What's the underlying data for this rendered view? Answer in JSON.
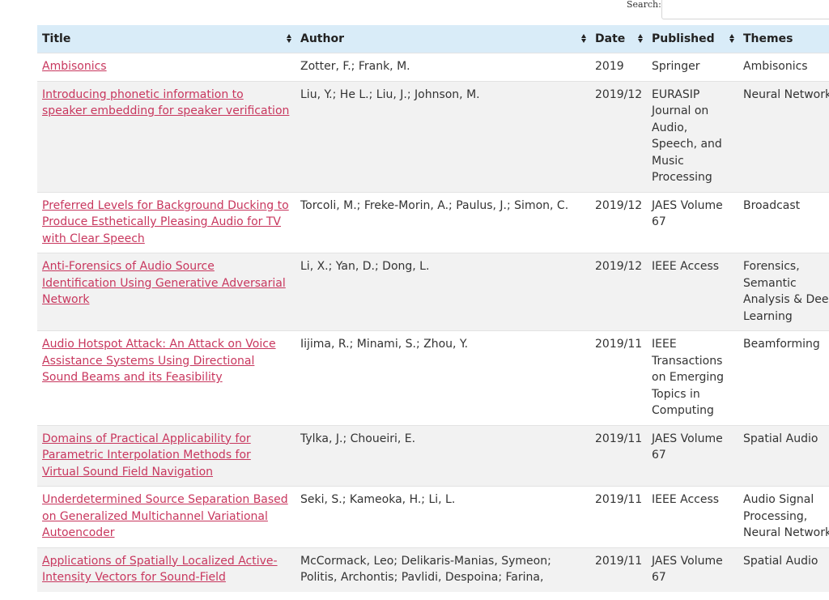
{
  "search": {
    "label": "Search:",
    "value": ""
  },
  "table": {
    "columns": [
      "Title",
      "Author",
      "Date",
      "Published",
      "Themes"
    ],
    "rows": [
      {
        "title": "Ambisonics",
        "author": "Zotter, F.; Frank, M.",
        "date": "2019",
        "published": "Springer",
        "themes": "Ambisonics"
      },
      {
        "title": "Introducing phonetic information to speaker embedding for speaker verification",
        "author": "Liu, Y.; He L.; Liu, J.; Johnson, M.",
        "date": "2019/12",
        "published": "EURASIP Journal on Audio, Speech, and Music Processing",
        "themes": "Neural Networks"
      },
      {
        "title": "Preferred Levels for Background Ducking to Produce Esthetically Pleasing Audio for TV with Clear Speech",
        "author": "Torcoli, M.; Freke-Morin, A.; Paulus, J.; Simon, C.",
        "date": "2019/12",
        "published": "JAES Volume 67",
        "themes": "Broadcast"
      },
      {
        "title": "Anti-Forensics of Audio Source Identification Using Generative Adversarial Network",
        "author": "Li, X.; Yan, D.; Dong, L.",
        "date": "2019/12",
        "published": "IEEE Access",
        "themes": "Forensics, Semantic Analysis & Deep Learning"
      },
      {
        "title": "Audio Hotspot Attack: An Attack on Voice Assistance Systems Using Directional Sound Beams and its Feasibility",
        "author": "Iijima, R.; Minami, S.; Zhou, Y.",
        "date": "2019/11",
        "published": "IEEE Transactions on Emerging Topics in Computing",
        "themes": "Beamforming"
      },
      {
        "title": "Domains of Practical Applicability for Parametric Interpolation Methods for Virtual Sound Field Navigation",
        "author": "Tylka, J.; Choueiri, E.",
        "date": "2019/11",
        "published": "JAES Volume 67",
        "themes": "Spatial Audio"
      },
      {
        "title": "Underdetermined Source Separation Based on Generalized Multichannel Variational Autoencoder",
        "author": "Seki, S.; Kameoka, H.; Li, L.",
        "date": "2019/11",
        "published": "IEEE Access",
        "themes": "Audio Signal Processing, Neural Networks"
      },
      {
        "title": "Applications of Spatially Localized Active-Intensity Vectors for Sound-Field",
        "author": "McCormack, Leo; Delikaris-Manias, Symeon; Politis, Archontis; Pavlidi, Despoina; Farina,",
        "date": "2019/11",
        "published": "JAES Volume 67",
        "themes": "Spatial Audio"
      }
    ]
  }
}
